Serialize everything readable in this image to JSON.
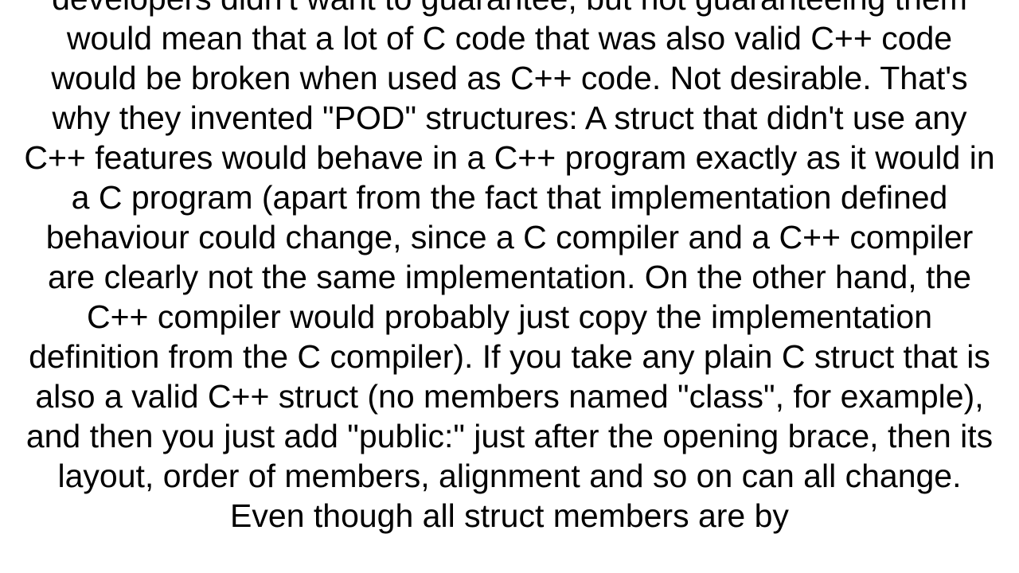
{
  "document": {
    "body_text": "developers didn't want to guarantee, but not guaranteeing them would mean that a lot of C code that was also valid C++ code would be broken when used as C++ code. Not desirable. That's why they invented \"POD\" structures: A struct that didn't use any C++ features would behave in a C++ program exactly as it would in a C program (apart from the fact that implementation defined behaviour could change, since a C compiler and a C++ compiler are clearly not the same implementation. On the other hand, the C++ compiler would probably just copy the implementation definition from the C compiler).  If you take any plain C struct that is also a valid C++ struct (no members named \"class\", for example), and then you just add \"public:\" just after the opening brace, then its layout, order of members, alignment and so on can all change. Even though all struct members are by"
  }
}
